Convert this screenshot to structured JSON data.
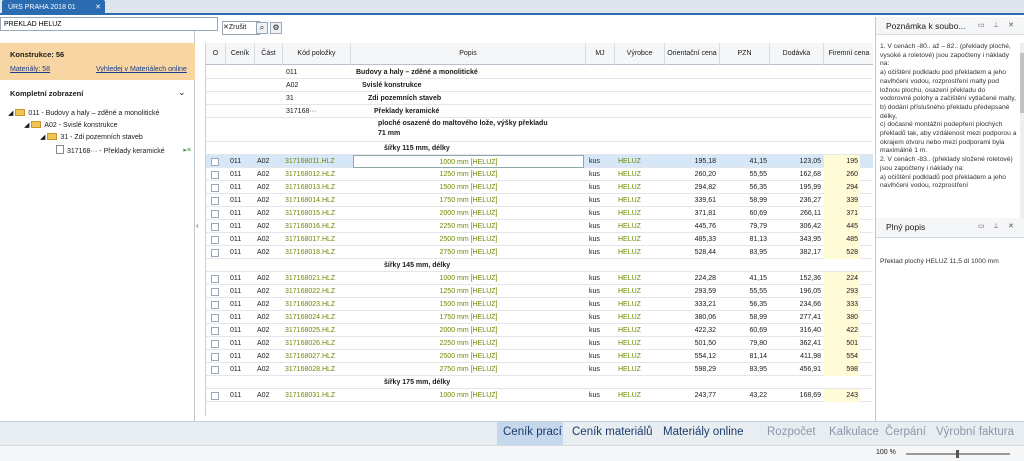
{
  "app": {
    "tab_label": "ÚRS PRAHA 2018 01"
  },
  "search": {
    "value": "PREKLAD HELUZ",
    "clear_label": "Zrušit"
  },
  "left_panel": {
    "title": "Konstrukce: 56",
    "link_materials": "Materiály: 58",
    "link_find": "Vyhledej v Materiálech online",
    "view_label": "Kompletní zobrazení",
    "tree": [
      {
        "label": "011 - Budovy a haly – zděné a monolitické"
      },
      {
        "label": "A02 - Svislé konstrukce"
      },
      {
        "label": "31 - Zdi pozemních staveb"
      },
      {
        "label": "317168··· - Překlady keramické"
      }
    ]
  },
  "grid": {
    "headers": [
      "O",
      "Ceník",
      "Část",
      "Kód položky",
      "Popis",
      "MJ",
      "Výrobce",
      "Orientační cena",
      "PZN",
      "Dodávka",
      "Firemní cena"
    ],
    "group_rows": [
      {
        "kod": "011",
        "popis": "Budovy a haly – zděné a monolitické"
      },
      {
        "kod": "A02",
        "popis": "Svislé konstrukce"
      },
      {
        "kod": "31",
        "popis": "Zdi pozemních staveb"
      },
      {
        "kod": "317168···",
        "popis": "Překlady keramické"
      }
    ],
    "desc_line1": "ploché osazené do maltového lože, výšky překladu",
    "desc_line2": "71 mm",
    "sections": [
      {
        "title": "šířky 115 mm, délky",
        "rows": [
          {
            "kod": "317168011.HLZ",
            "popis": "1000 mm [HELUZ]",
            "cena": "195,18",
            "pzn": "41,15",
            "dod": "123,05",
            "fir": "195"
          },
          {
            "kod": "317168012.HLZ",
            "popis": "1250 mm [HELUZ]",
            "cena": "260,20",
            "pzn": "55,55",
            "dod": "162,68",
            "fir": "260"
          },
          {
            "kod": "317168013.HLZ",
            "popis": "1500 mm [HELUZ]",
            "cena": "294,82",
            "pzn": "56,35",
            "dod": "195,99",
            "fir": "294"
          },
          {
            "kod": "317168014.HLZ",
            "popis": "1750 mm [HELUZ]",
            "cena": "339,61",
            "pzn": "58,99",
            "dod": "236,27",
            "fir": "339"
          },
          {
            "kod": "317168015.HLZ",
            "popis": "2000 mm [HELUZ]",
            "cena": "371,81",
            "pzn": "60,69",
            "dod": "266,11",
            "fir": "371"
          },
          {
            "kod": "317168016.HLZ",
            "popis": "2250 mm [HELUZ]",
            "cena": "445,76",
            "pzn": "79,79",
            "dod": "306,42",
            "fir": "445"
          },
          {
            "kod": "317168017.HLZ",
            "popis": "2500 mm [HELUZ]",
            "cena": "485,33",
            "pzn": "81,13",
            "dod": "343,95",
            "fir": "485"
          },
          {
            "kod": "317168018.HLZ",
            "popis": "2750 mm [HELUZ]",
            "cena": "528,44",
            "pzn": "83,95",
            "dod": "382,17",
            "fir": "528"
          }
        ]
      },
      {
        "title": "šířky 145 mm, délky",
        "rows": [
          {
            "kod": "317168021.HLZ",
            "popis": "1000 mm [HELUZ]",
            "cena": "224,28",
            "pzn": "41,15",
            "dod": "152,36",
            "fir": "224"
          },
          {
            "kod": "317168022.HLZ",
            "popis": "1250 mm [HELUZ]",
            "cena": "293,59",
            "pzn": "55,55",
            "dod": "196,05",
            "fir": "293"
          },
          {
            "kod": "317168023.HLZ",
            "popis": "1500 mm [HELUZ]",
            "cena": "333,21",
            "pzn": "56,35",
            "dod": "234,66",
            "fir": "333"
          },
          {
            "kod": "317168024.HLZ",
            "popis": "1750 mm [HELUZ]",
            "cena": "380,06",
            "pzn": "58,99",
            "dod": "277,41",
            "fir": "380"
          },
          {
            "kod": "317168025.HLZ",
            "popis": "2000 mm [HELUZ]",
            "cena": "422,32",
            "pzn": "60,69",
            "dod": "316,40",
            "fir": "422"
          },
          {
            "kod": "317168026.HLZ",
            "popis": "2250 mm [HELUZ]",
            "cena": "501,50",
            "pzn": "79,80",
            "dod": "362,41",
            "fir": "501"
          },
          {
            "kod": "317168027.HLZ",
            "popis": "2500 mm [HELUZ]",
            "cena": "554,12",
            "pzn": "81,14",
            "dod": "411,98",
            "fir": "554"
          },
          {
            "kod": "317168028.HLZ",
            "popis": "2750 mm [HELUZ]",
            "cena": "598,29",
            "pzn": "83,95",
            "dod": "456,91",
            "fir": "598"
          }
        ]
      },
      {
        "title": "šířky 175 mm, délky",
        "rows": [
          {
            "kod": "317168031.HLZ",
            "popis": "1000 mm [HELUZ]",
            "cena": "243,77",
            "pzn": "43,22",
            "dod": "168,69",
            "fir": "243"
          }
        ]
      }
    ],
    "cenik": "011",
    "cast": "A02",
    "mj": "kus",
    "vyrobce": "HELUZ"
  },
  "right_panel": {
    "note_title": "Poznámka k soubo...",
    "note_text": "1. V cenách -80.. až – 82.. (překlady ploché, vysoké a roletové) jsou započteny i náklady na:\na) očištění podkladu pod překladem a jeho navlhčení vodou, rozprostření malty pod ložnou plochu, osazení překladu do vodorovné polohy a začištění vytlačené malty,\nb) dodání příslušného překladu předepsané délky,\nc) dočasné montážní podepření plochých překladů tak, aby vzdálenost mezi podporou a okrajem otvoru nebo mezi podporami byla maximálně 1 m.\n2. V cenách -83.. (překlady složené roletové) jsou započteny i náklady na:\na) očištění podkladů pod překladem a jeho navlhčení vodou, rozprostření",
    "full_title": "Plný popis",
    "full_text": "Překlad plochý HELUZ 11,5 dl 1000 mm"
  },
  "bottom_tabs": [
    "Ceník prací",
    "Ceník materiálů",
    "Materiály online",
    "Rozpočet",
    "Kalkulace",
    "Čerpání",
    "Výrobní faktura"
  ],
  "status": {
    "zoom": "100 %"
  }
}
